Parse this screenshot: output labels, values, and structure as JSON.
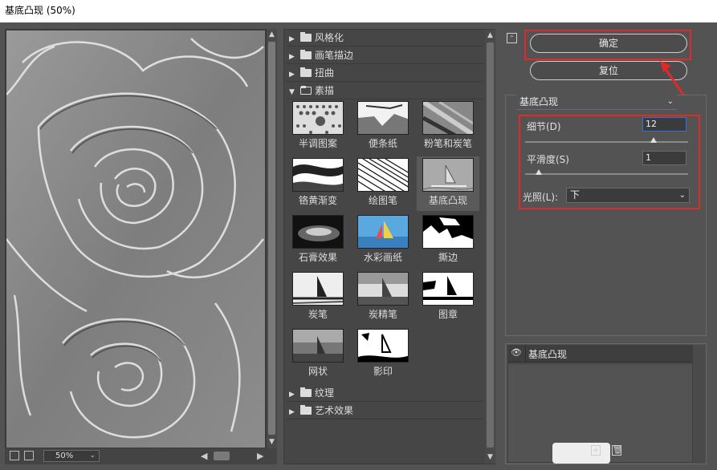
{
  "window": {
    "title": "基底凸现 (50%)"
  },
  "preview": {
    "zoom": "50%"
  },
  "gallery": {
    "folders_top": [
      {
        "label": "风格化",
        "expanded": false
      },
      {
        "label": "画笔描边",
        "expanded": false
      },
      {
        "label": "扭曲",
        "expanded": false
      },
      {
        "label": "素描",
        "expanded": true
      }
    ],
    "sketch_filters": [
      {
        "label": "半调图案",
        "icon": "halftone-thumb"
      },
      {
        "label": "便条纸",
        "icon": "note-paper-thumb"
      },
      {
        "label": "粉笔和炭笔",
        "icon": "chalk-charcoal-thumb"
      },
      {
        "label": "铬黄渐变",
        "icon": "chrome-thumb"
      },
      {
        "label": "绘图笔",
        "icon": "graphic-pen-thumb"
      },
      {
        "label": "基底凸现",
        "icon": "bas-relief-thumb",
        "selected": true
      },
      {
        "label": "石膏效果",
        "icon": "plaster-thumb"
      },
      {
        "label": "水彩画纸",
        "icon": "water-paper-thumb"
      },
      {
        "label": "撕边",
        "icon": "torn-edges-thumb"
      },
      {
        "label": "炭笔",
        "icon": "charcoal-thumb"
      },
      {
        "label": "炭精笔",
        "icon": "conte-crayon-thumb"
      },
      {
        "label": "图章",
        "icon": "stamp-thumb"
      },
      {
        "label": "网状",
        "icon": "reticulation-thumb"
      },
      {
        "label": "影印",
        "icon": "photocopy-thumb"
      }
    ],
    "folders_bottom": [
      {
        "label": "纹理",
        "expanded": false
      },
      {
        "label": "艺术效果",
        "expanded": false
      }
    ]
  },
  "buttons": {
    "ok": "确定",
    "reset": "复位"
  },
  "settings": {
    "filter_name": "基底凸现",
    "detail": {
      "label": "细节(D)",
      "value": "12",
      "max": 15
    },
    "smoothness": {
      "label": "平滑度(S)",
      "value": "1",
      "max": 15
    },
    "light": {
      "label": "光照(L):",
      "value": "下"
    }
  },
  "layers": {
    "items": [
      {
        "name": "基底凸现",
        "visible": true
      }
    ]
  },
  "colors": {
    "highlight": "#e02a2a",
    "panel": "#535353",
    "input_focus": "#2f74d8"
  }
}
